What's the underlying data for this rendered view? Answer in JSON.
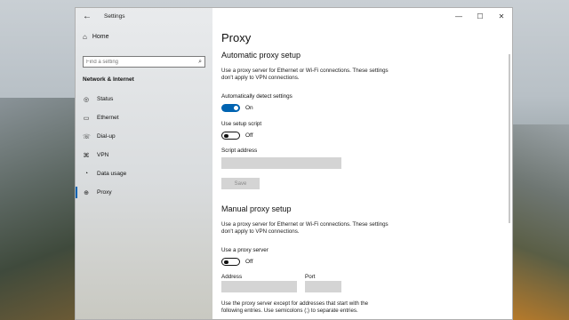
{
  "window": {
    "app_title": "Settings",
    "controls": {
      "minimize": "—",
      "maximize": "☐",
      "close": "✕"
    }
  },
  "sidebar": {
    "home_label": "Home",
    "search_placeholder": "Find a setting",
    "section_title": "Network & Internet",
    "items": [
      {
        "label": "Status",
        "icon": "globe-icon",
        "glyph": "◎"
      },
      {
        "label": "Ethernet",
        "icon": "ethernet-icon",
        "glyph": "▭"
      },
      {
        "label": "Dial-up",
        "icon": "phone-icon",
        "glyph": "☏"
      },
      {
        "label": "VPN",
        "icon": "vpn-icon",
        "glyph": "⌘"
      },
      {
        "label": "Data usage",
        "icon": "data-usage-icon",
        "glyph": "◔"
      },
      {
        "label": "Proxy",
        "icon": "globe-icon",
        "glyph": "⊕",
        "active": true
      }
    ]
  },
  "content": {
    "page_title": "Proxy",
    "auto": {
      "heading": "Automatic proxy setup",
      "desc_line1": "Use a proxy server for Ethernet or Wi-Fi connections. These settings",
      "desc_line2": "don't apply to VPN connections.",
      "auto_detect_label": "Automatically detect settings",
      "auto_detect_state": "On",
      "setup_script_label": "Use setup script",
      "setup_script_state": "Off",
      "script_address_label": "Script address",
      "script_address_value": "",
      "save_label": "Save"
    },
    "manual": {
      "heading": "Manual proxy setup",
      "desc_line1": "Use a proxy server for Ethernet or Wi-Fi connections. These settings",
      "desc_line2": "don't apply to VPN connections.",
      "use_proxy_label": "Use a proxy server",
      "use_proxy_state": "Off",
      "address_label": "Address",
      "address_value": "",
      "port_label": "Port",
      "port_value": "",
      "except_line1": "Use the proxy server except for addresses that start with the",
      "except_line2": "following entries. Use semicolons (;) to separate entries."
    }
  },
  "colors": {
    "accent": "#0063b1",
    "disabled": "#d4d4d4"
  }
}
